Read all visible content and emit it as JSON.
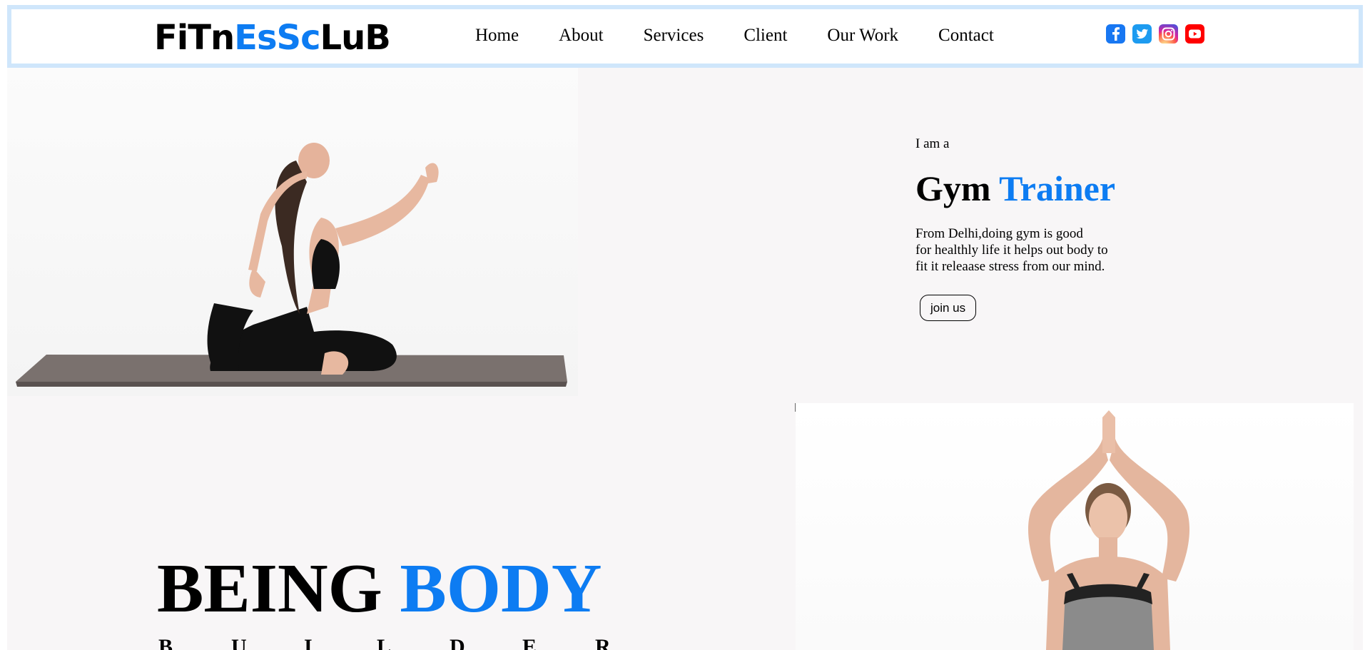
{
  "header": {
    "logo": {
      "part1": "FiTn",
      "part2": "EsSc",
      "part3": "LuB"
    },
    "nav": [
      {
        "label": "Home"
      },
      {
        "label": "About"
      },
      {
        "label": "Services"
      },
      {
        "label": "Client"
      },
      {
        "label": "Our Work"
      },
      {
        "label": "Contact"
      }
    ],
    "social": [
      {
        "icon": "facebook-icon"
      },
      {
        "icon": "twitter-icon"
      },
      {
        "icon": "instagram-icon"
      },
      {
        "icon": "youtube-icon"
      }
    ]
  },
  "intro": {
    "small": "I am a",
    "title_dark": "Gym",
    "title_blue": "Trainer",
    "desc_line1": "From Delhi,doing gym is good",
    "desc_line2": "for healthly life it helps out body to",
    "desc_line3": "fit it releaase stress from our mind.",
    "button": "join us"
  },
  "being": {
    "dark": "BEING",
    "blue": "BODY",
    "letters": [
      "B",
      "U",
      "I",
      "L",
      "D",
      "E",
      "R"
    ]
  },
  "colors": {
    "accent": "#0d7cf2",
    "header_border": "#cfe6fb",
    "hero_bg": "#f8f6f7"
  }
}
